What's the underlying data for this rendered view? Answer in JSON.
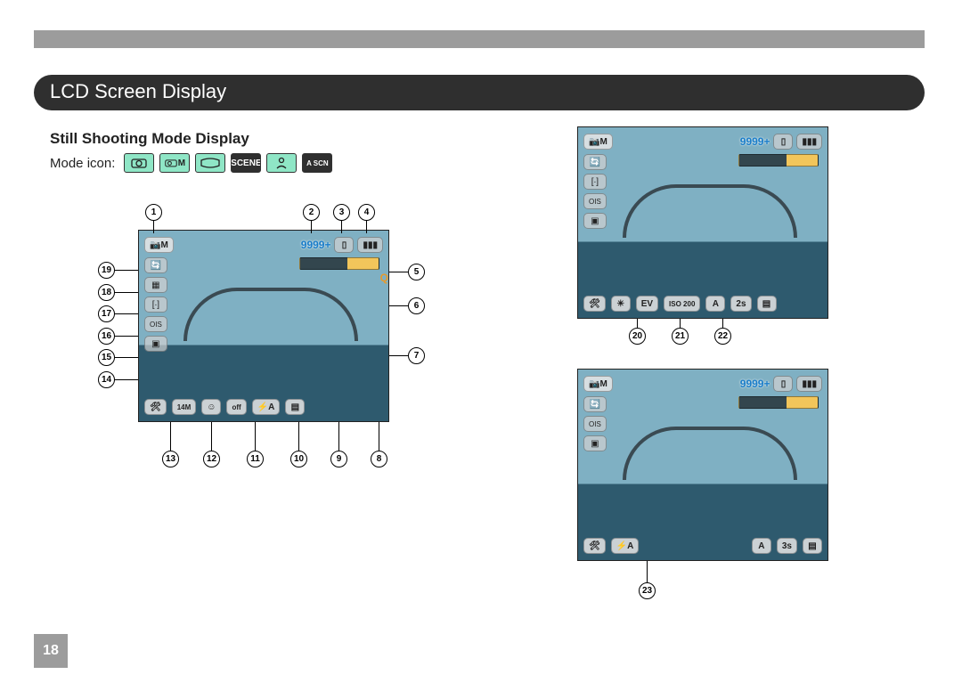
{
  "section_title": "LCD Screen Display",
  "sub_heading": "Still Shooting Mode Display",
  "mode_icon_label": "Mode icon:",
  "mode_icons": [
    "camera",
    "M",
    "pano",
    "SCENE",
    "portrait",
    "A SCN"
  ],
  "page_number": "18",
  "lcd": {
    "mode_badge": "M",
    "remaining_shots": "9999+",
    "card_icon": "sd",
    "battery_icon": "full",
    "zoom_q": "Q",
    "left_icons": [
      "ae-lock",
      "grid",
      "focus",
      "ois",
      "drive"
    ],
    "bottom_icons": [
      "tools",
      "size-14M",
      "face",
      "wb-off",
      "flash-auto",
      "quality"
    ]
  },
  "lcd_a": {
    "bottom_labels": [
      "tools",
      "ev",
      "EV",
      "ISO 200",
      "A",
      "2s",
      "qual"
    ]
  },
  "lcd_b": {
    "bottom_labels": [
      "tools",
      "flash-A",
      "A",
      "3s",
      "qual"
    ]
  },
  "callouts_main": {
    "top": {
      "1": 1,
      "2": 2,
      "3": 3,
      "4": 4
    },
    "right": {
      "5": 5,
      "6": 6,
      "7": 7
    },
    "left": {
      "14": 14,
      "15": 15,
      "16": 16,
      "17": 17,
      "18": 18,
      "19": 19
    },
    "bottom": {
      "8": 8,
      "9": 9,
      "10": 10,
      "11": 11,
      "12": 12,
      "13": 13
    }
  },
  "callouts_a": {
    "20": 20,
    "21": 21,
    "22": 22
  },
  "callouts_b": {
    "23": 23
  }
}
